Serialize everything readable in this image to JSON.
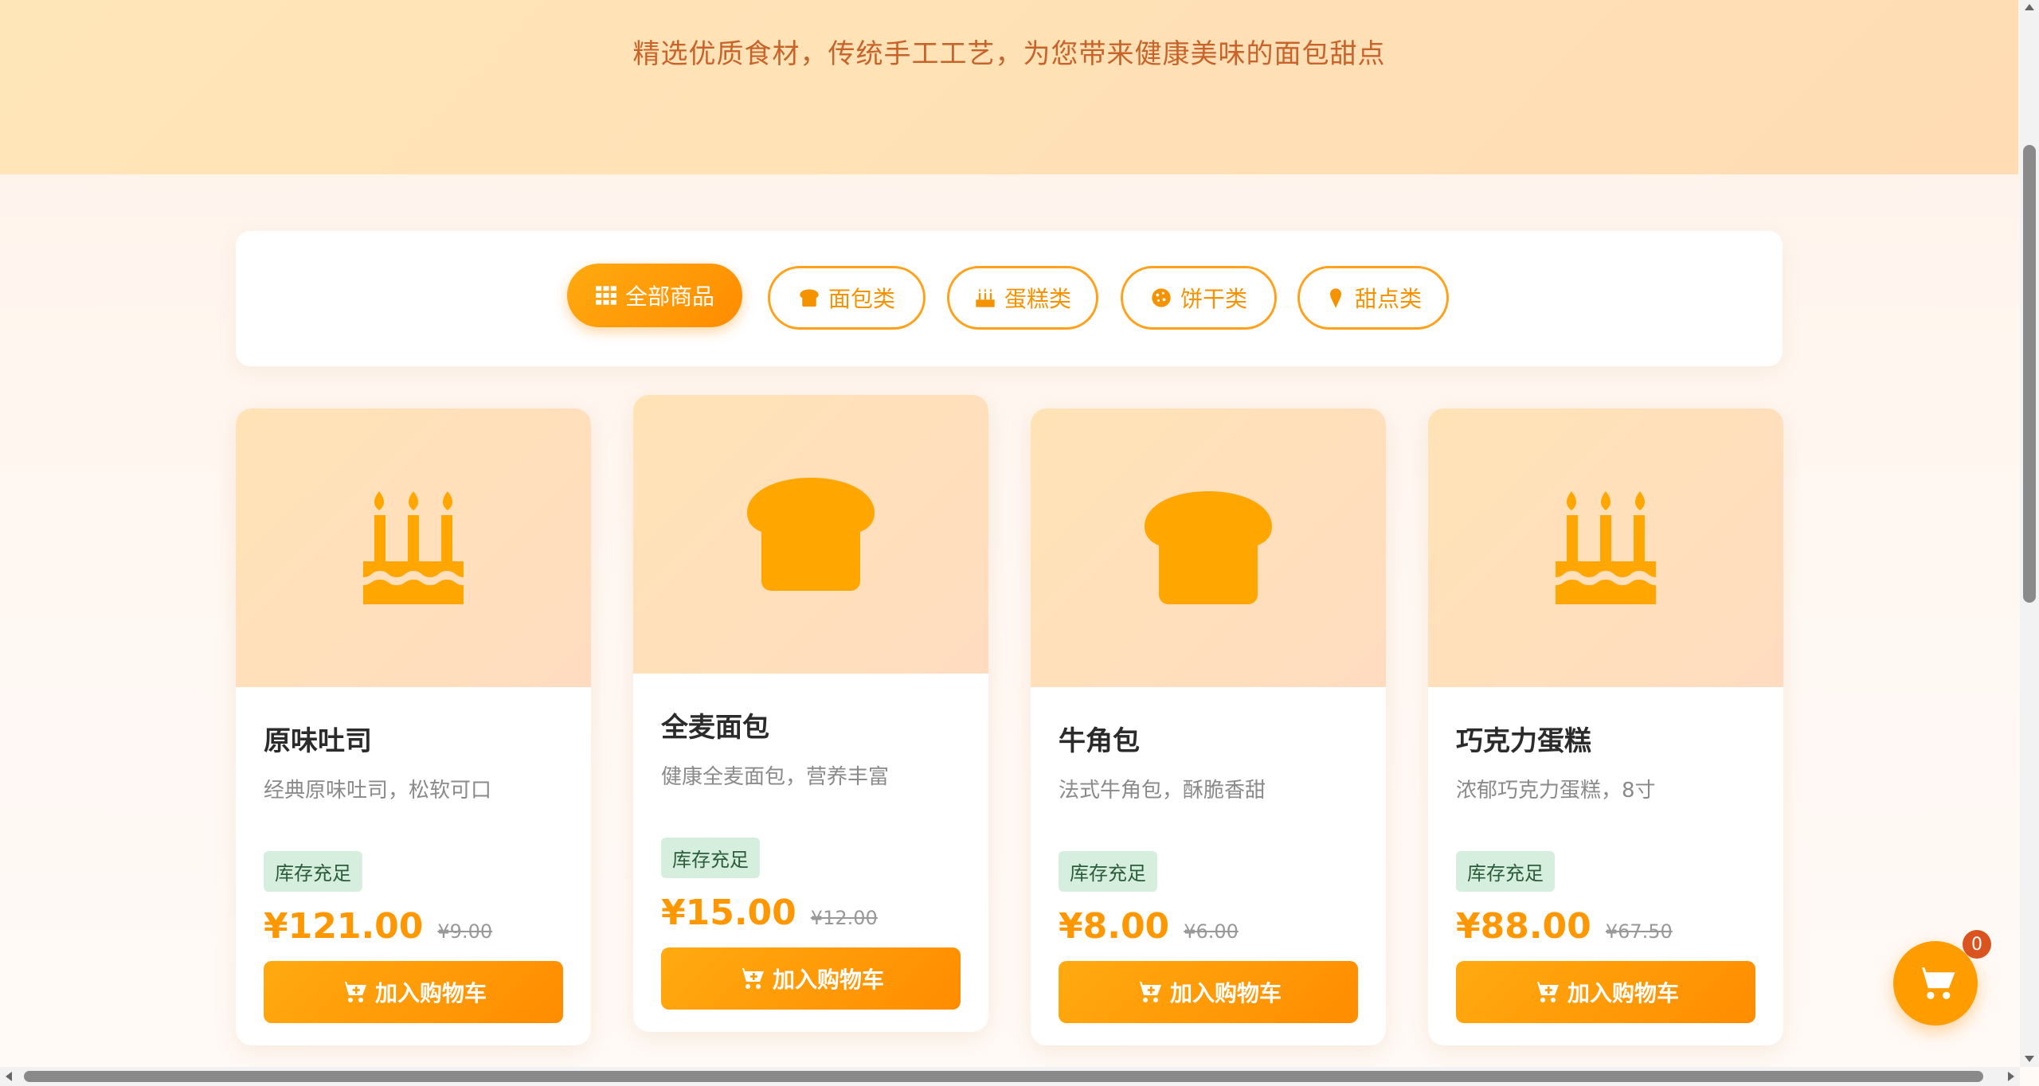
{
  "hero": {
    "subtitle": "精选优质食材，传统手工工艺，为您带来健康美味的面包甜点"
  },
  "filters": [
    {
      "label": "全部商品",
      "icon": "grid-icon",
      "active": true
    },
    {
      "label": "面包类",
      "icon": "bread-icon",
      "active": false
    },
    {
      "label": "蛋糕类",
      "icon": "cake-icon",
      "active": false
    },
    {
      "label": "饼干类",
      "icon": "cookie-icon",
      "active": false
    },
    {
      "label": "甜点类",
      "icon": "ice-cream-icon",
      "active": false
    }
  ],
  "products": [
    {
      "name": "原味吐司",
      "desc": "经典原味吐司，松软可口",
      "stock": "库存充足",
      "price": "¥121.00",
      "original_price": "¥9.00",
      "icon": "cake-icon",
      "button": "加入购物车"
    },
    {
      "name": "全麦面包",
      "desc": "健康全麦面包，营养丰富",
      "stock": "库存充足",
      "price": "¥15.00",
      "original_price": "¥12.00",
      "icon": "bread-icon",
      "button": "加入购物车"
    },
    {
      "name": "牛角包",
      "desc": "法式牛角包，酥脆香甜",
      "stock": "库存充足",
      "price": "¥8.00",
      "original_price": "¥6.00",
      "icon": "bread-icon",
      "button": "加入购物车"
    },
    {
      "name": "巧克力蛋糕",
      "desc": "浓郁巧克力蛋糕，8寸",
      "stock": "库存充足",
      "price": "¥88.00",
      "original_price": "¥67.50",
      "icon": "cake-icon",
      "button": "加入购物车"
    }
  ],
  "cart": {
    "count": "0",
    "icon": "shopping-cart-icon"
  },
  "colors": {
    "accent": "#ff9800",
    "hero_text": "#c8632a",
    "stock_bg": "#d6eedd"
  }
}
